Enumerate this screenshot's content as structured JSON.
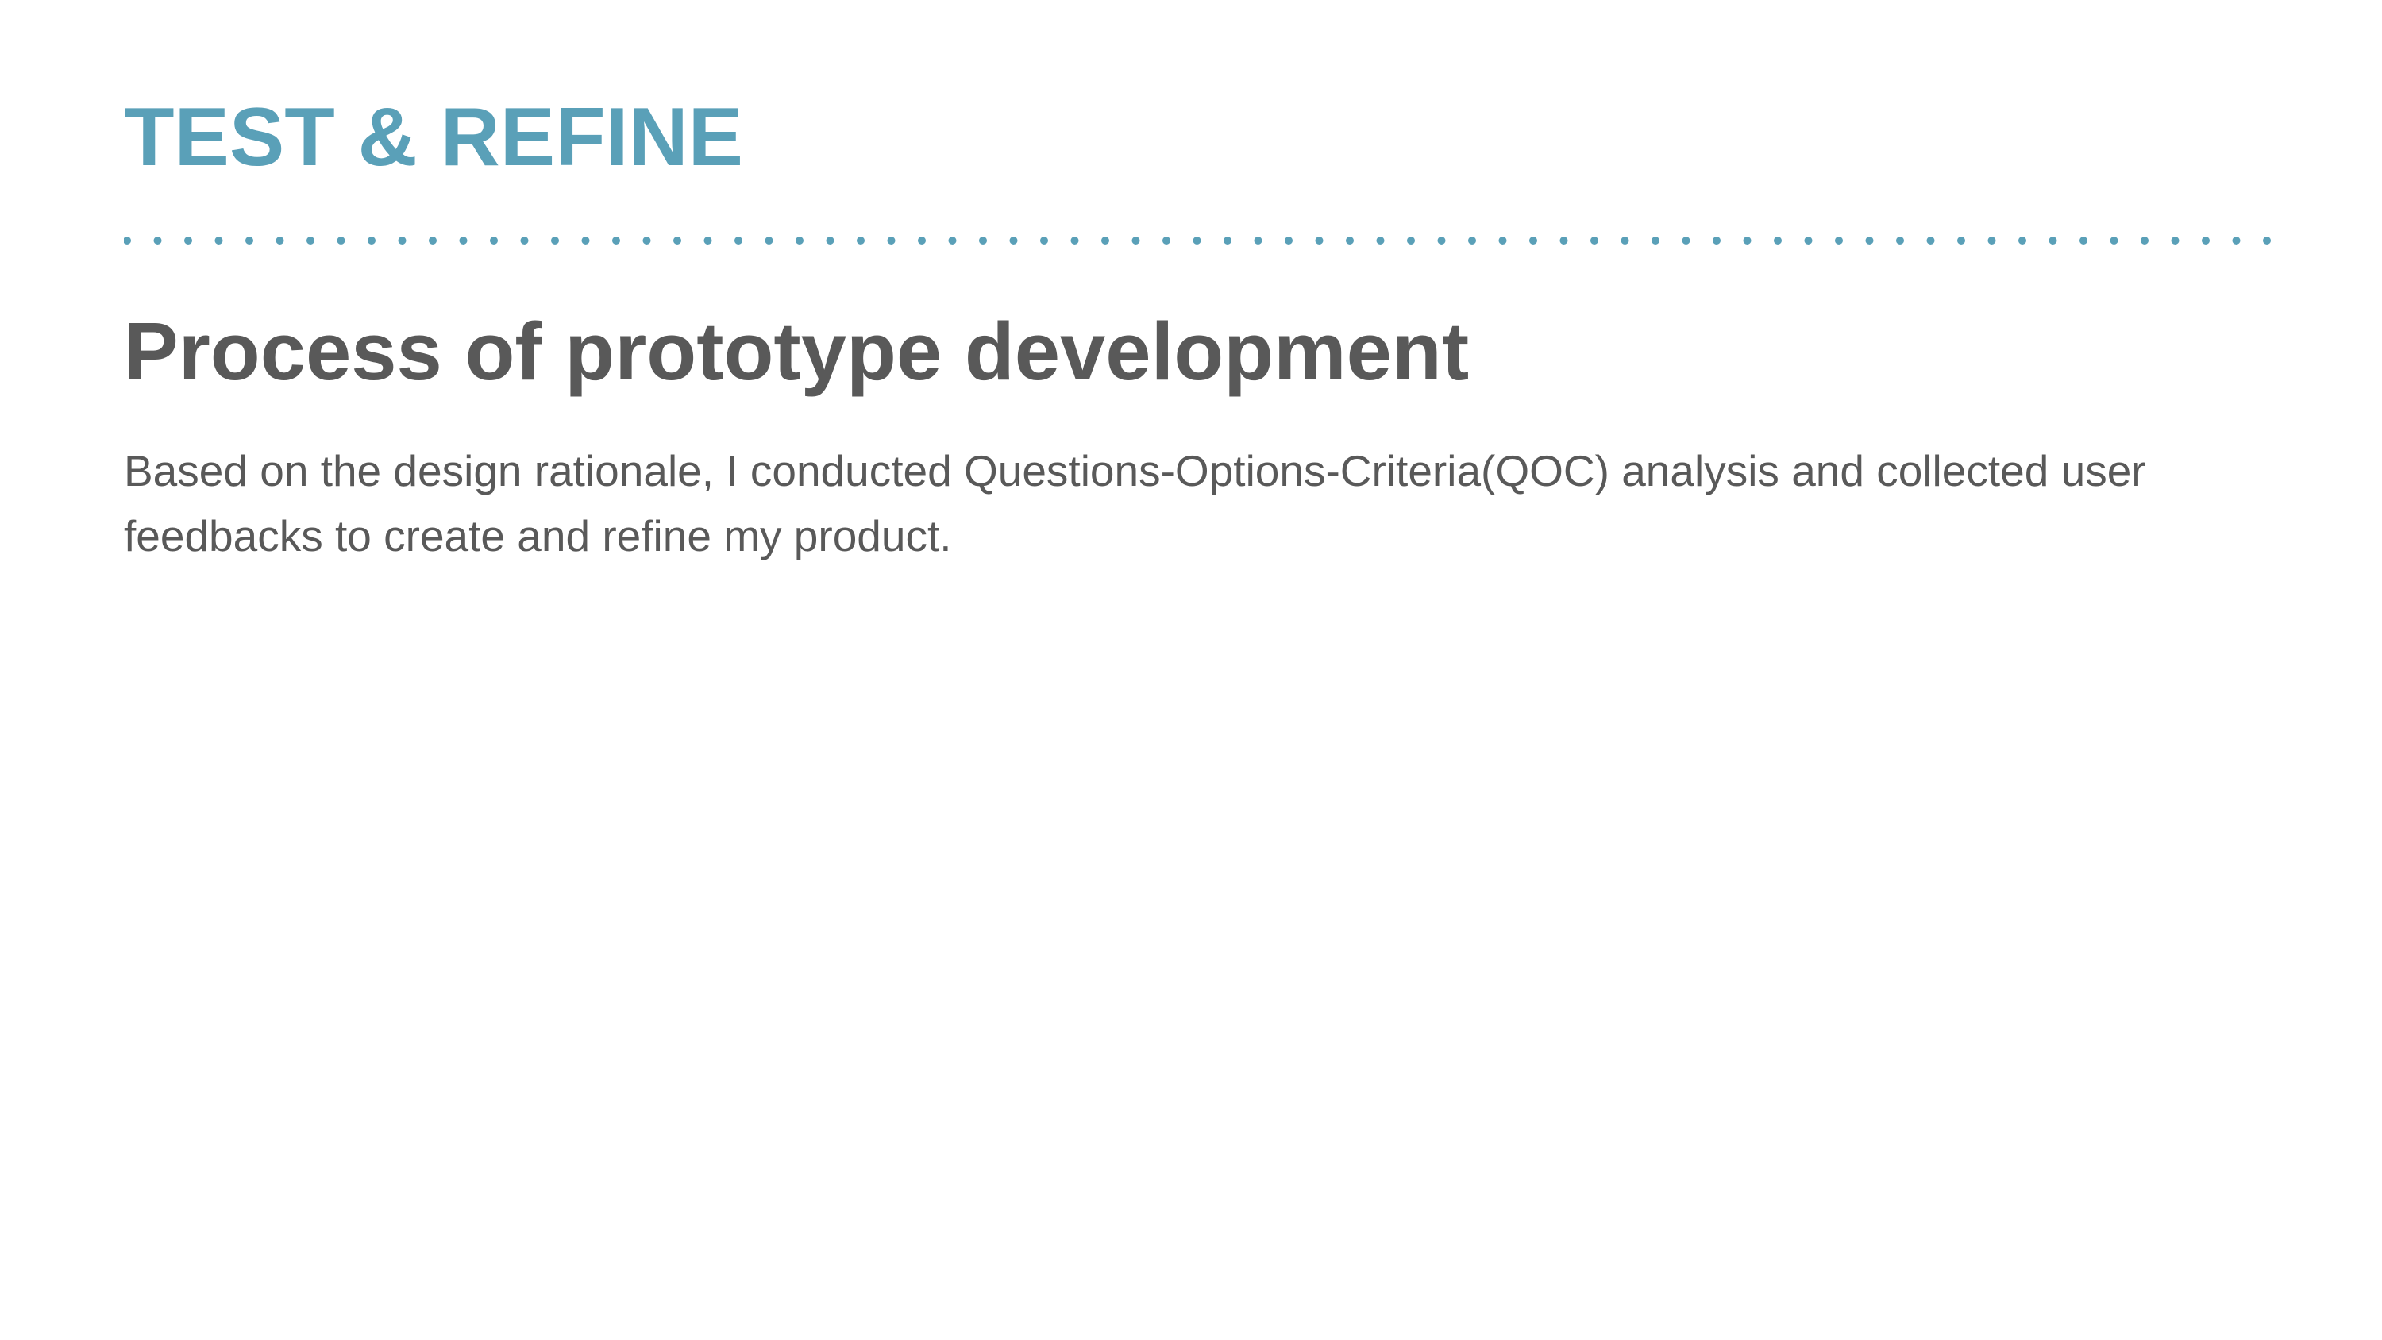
{
  "section": {
    "label": "TEST & REFINE"
  },
  "content": {
    "title": "Process of prototype development",
    "paragraph": "Based on the design rationale, I conducted Questions-Options-Criteria(QOC) analysis and collected user feedbacks to create and refine my product."
  },
  "colors": {
    "accent": "#5aa0b8",
    "text": "#595959",
    "background": "#ffffff"
  }
}
